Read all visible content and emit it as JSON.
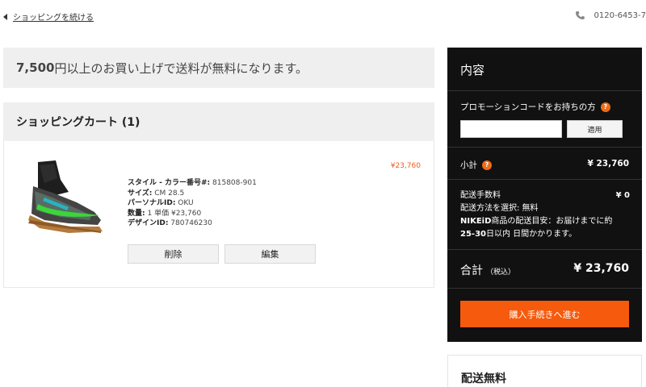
{
  "header": {
    "continue_shopping": "ショッピングを続ける",
    "phone": "0120-6453-7"
  },
  "promo_banner": {
    "amount": "7,500",
    "text": "円以上のお買い上げで送料が無料になります。"
  },
  "cart": {
    "title": "ショッピングカート (1)",
    "item": {
      "price": "¥23,760",
      "style_label": "スタイル - カラー番号#:",
      "style_value": "815808-901",
      "size_label": "サイズ:",
      "size_value": "CM  28.5",
      "personal_id_label": "パーソナルID:",
      "personal_id_value": "OKU",
      "qty_label": "数量:",
      "qty_value": "1",
      "unit_price_label": "単価",
      "unit_price_value": "¥23,760",
      "design_id_label": "デザインID:",
      "design_id_value": "780746230",
      "delete_label": "削除",
      "edit_label": "編集"
    }
  },
  "summary": {
    "title": "内容",
    "promo_code_label": "プロモーションコードをお持ちの方",
    "promo_code_value": "",
    "apply_label": "適用",
    "subtotal_label": "小計",
    "subtotal_value": "¥ 23,760",
    "shipping_fee_label": "配送手数料",
    "shipping_fee_value": "¥ 0",
    "shipping_method": "配送方法を選択: 無料",
    "nikeid_bold": "NIKEiD",
    "delivery_estimate_1": "商品の配送目安：お届けまでに約",
    "delivery_days_bold": "25-30",
    "delivery_estimate_2": "日以内 日間かかります。",
    "total_label": "合計",
    "tax_label": "（税込）",
    "total_value": "¥ 23,760",
    "checkout_label": "購入手続きへ進む",
    "help_icon_text": "?"
  },
  "free_shipping": {
    "title": "配送無料"
  },
  "colors": {
    "accent": "#f55a0d",
    "price": "#f05a1a",
    "summary_bg": "#111111",
    "banner_bg": "#efefef"
  },
  "icons": {
    "back": "chevron-left-icon",
    "phone": "phone-icon",
    "help": "help-icon"
  }
}
